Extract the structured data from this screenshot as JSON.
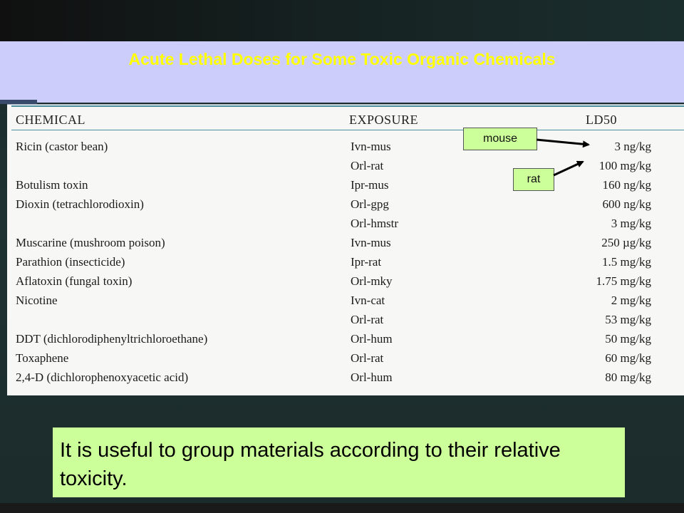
{
  "slide": {
    "title": "Acute Lethal Doses for Some Toxic Organic Chemicals",
    "note": "It is useful to group materials according to their relative toxicity."
  },
  "table": {
    "headers": {
      "chemical": "CHEMICAL",
      "exposure": "EXPOSURE",
      "ld50": "LD50"
    },
    "rows": [
      {
        "chemical": "Ricin (castor bean)",
        "exposure": "Ivn-mus",
        "ld50": "3 ng/kg"
      },
      {
        "chemical": "",
        "exposure": "Orl-rat",
        "ld50": "100 mg/kg"
      },
      {
        "chemical": "Botulism toxin",
        "exposure": "Ipr-mus",
        "ld50": "160 ng/kg"
      },
      {
        "chemical": "Dioxin (tetrachlorodioxin)",
        "exposure": "Orl-gpg",
        "ld50": "600 ng/kg"
      },
      {
        "chemical": "",
        "exposure": "Orl-hmstr",
        "ld50": "3 mg/kg"
      },
      {
        "chemical": "Muscarine (mushroom poison)",
        "exposure": "Ivn-mus",
        "ld50": "250 µg/kg"
      },
      {
        "chemical": "Parathion (insecticide)",
        "exposure": "Ipr-rat",
        "ld50": "1.5 mg/kg"
      },
      {
        "chemical": "Aflatoxin (fungal toxin)",
        "exposure": "Orl-mky",
        "ld50": "1.75 mg/kg"
      },
      {
        "chemical": "Nicotine",
        "exposure": "Ivn-cat",
        "ld50": "2 mg/kg"
      },
      {
        "chemical": "",
        "exposure": "Orl-rat",
        "ld50": "53 mg/kg"
      },
      {
        "chemical": "DDT (dichlorodiphenyltrichloroethane)",
        "exposure": "Orl-hum",
        "ld50": "50 mg/kg"
      },
      {
        "chemical": "Toxaphene",
        "exposure": "Orl-rat",
        "ld50": "60 mg/kg"
      },
      {
        "chemical": "2,4-D (dichlorophenoxyacetic acid)",
        "exposure": "Orl-hum",
        "ld50": "80 mg/kg"
      }
    ]
  },
  "callouts": {
    "mouse": "mouse",
    "rat": "rat"
  },
  "colors": {
    "title_text": "#ffff00",
    "title_panel": "#cdcdfb",
    "callout_bg": "#ccff99",
    "note_bg": "#ccff99",
    "rule": "#4e8f9d"
  }
}
